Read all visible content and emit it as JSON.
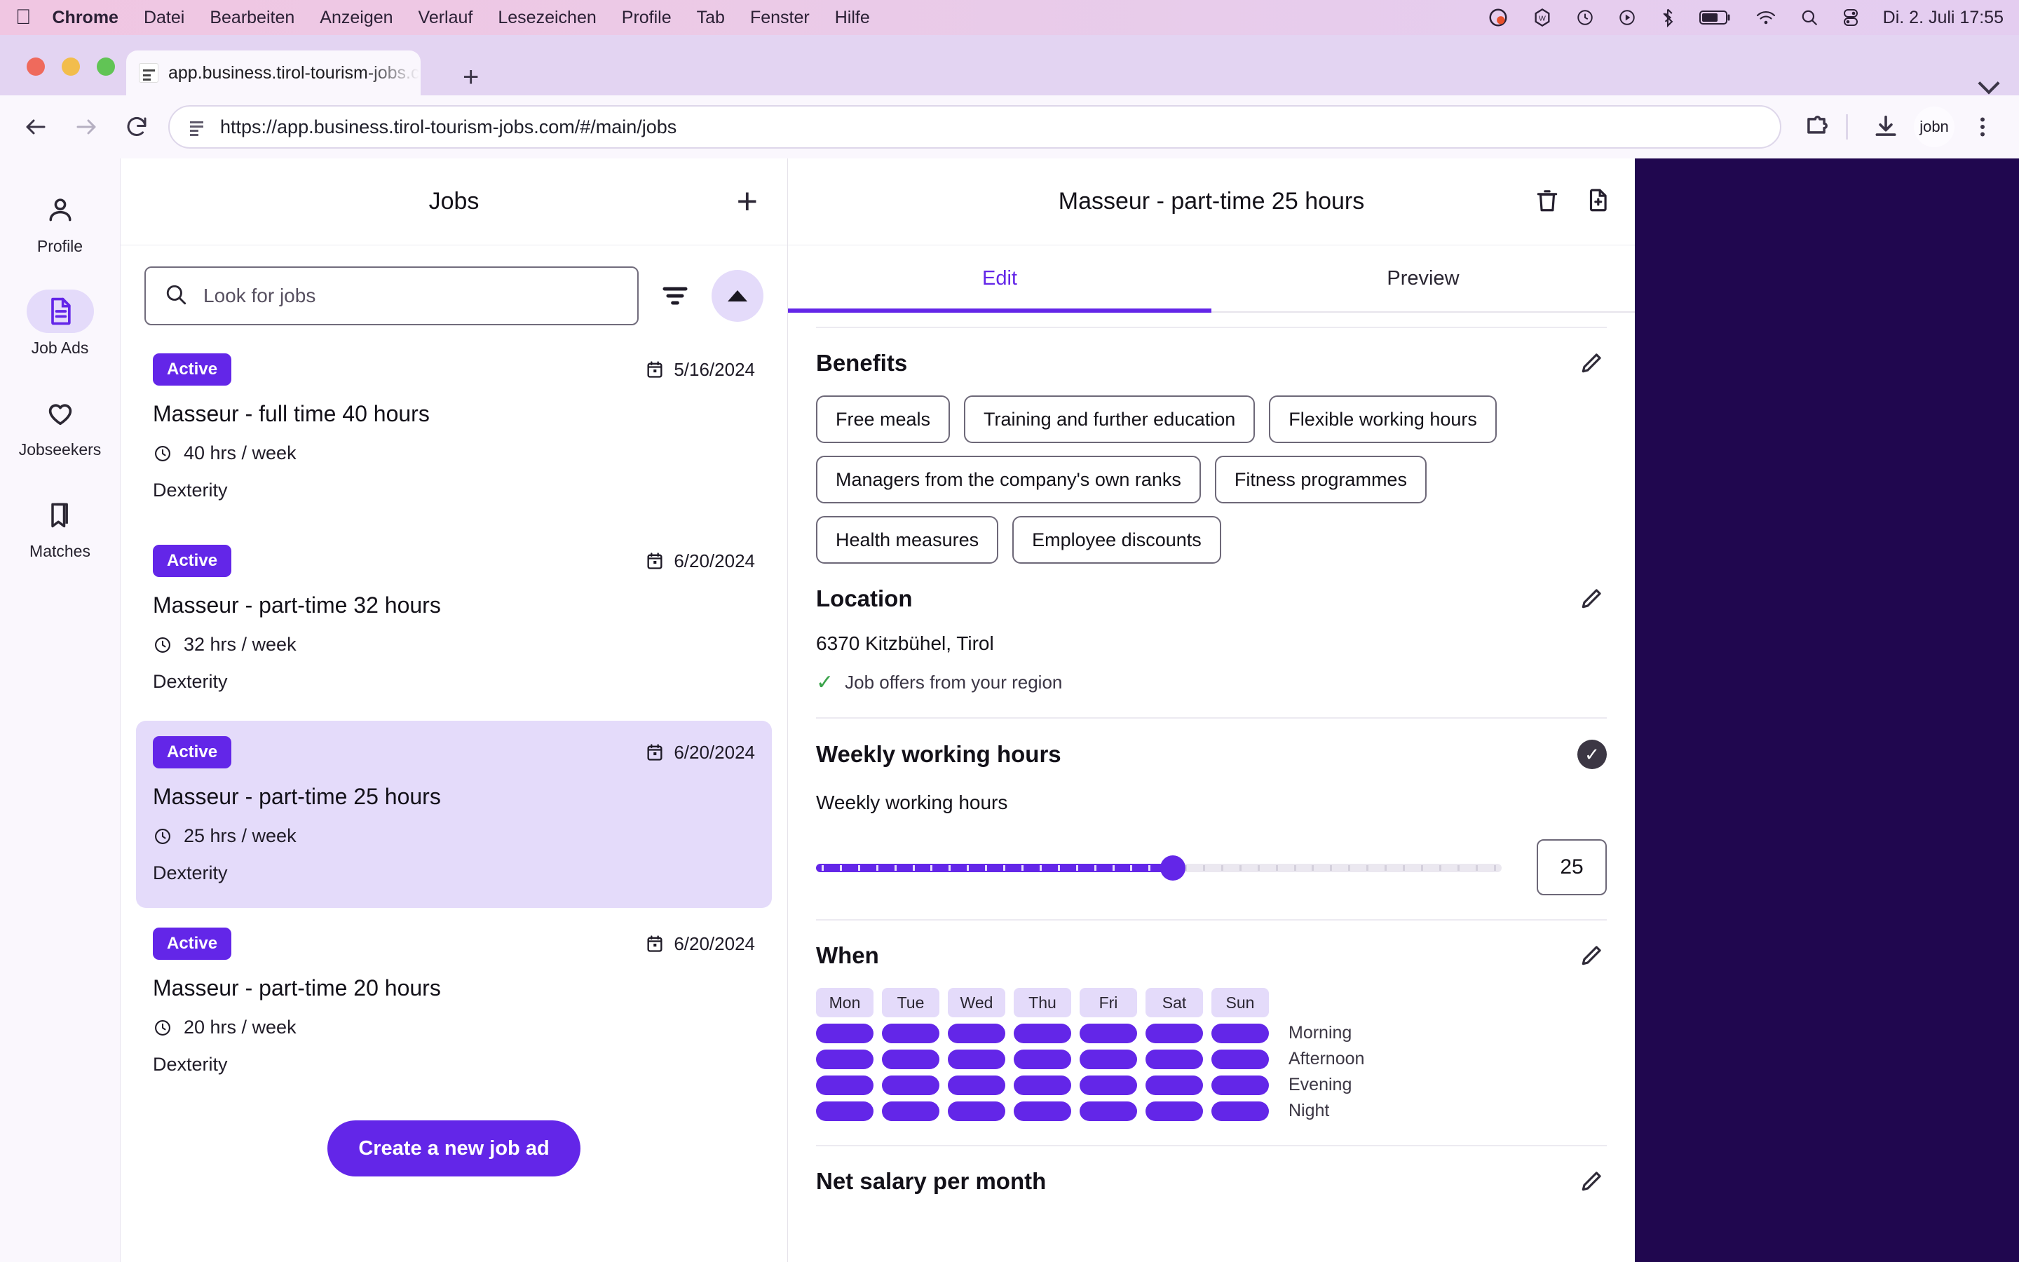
{
  "menubar": {
    "apple": "apple-logo",
    "items": [
      "Chrome",
      "Datei",
      "Bearbeiten",
      "Anzeigen",
      "Verlauf",
      "Lesezeichen",
      "Profile",
      "Tab",
      "Fenster",
      "Hilfe"
    ],
    "status_icons": [
      "grammarly-icon",
      "wordpress-icon",
      "time-machine-icon",
      "screen-record-icon",
      "bluetooth-icon",
      "battery-icon",
      "wifi-icon",
      "spotlight-search-icon",
      "control-center-icon"
    ],
    "clock": "Di. 2. Juli  17:55"
  },
  "browser": {
    "tab_title": "app.business.tirol-tourism-jobs.c",
    "new_tab_label": "+",
    "url": "https://app.business.tirol-tourism-jobs.com/#/main/jobs",
    "avatar_label": "jobn"
  },
  "sidebar": {
    "items": [
      {
        "label": "Profile",
        "icon": "person-icon",
        "active": false
      },
      {
        "label": "Job Ads",
        "icon": "document-icon",
        "active": true
      },
      {
        "label": "Jobseekers",
        "icon": "heart-icon",
        "active": false
      },
      {
        "label": "Matches",
        "icon": "bookmark-icon",
        "active": false
      }
    ]
  },
  "jobs_panel": {
    "title": "Jobs",
    "add_label": "+",
    "search_placeholder": "Look for jobs",
    "search_value": "",
    "filter_icon": "filter-icon",
    "collapse_icon": "chevron-up-icon",
    "create_button": "Create a new job ad",
    "items": [
      {
        "status": "Active",
        "date": "5/16/2024",
        "title": "Masseur - full time 40 hours",
        "hours": "40 hrs / week",
        "skill": "Dexterity",
        "selected": false
      },
      {
        "status": "Active",
        "date": "6/20/2024",
        "title": "Masseur - part-time 32 hours",
        "hours": "32 hrs / week",
        "skill": "Dexterity",
        "selected": false
      },
      {
        "status": "Active",
        "date": "6/20/2024",
        "title": "Masseur - part-time 25 hours",
        "hours": "25 hrs / week",
        "skill": "Dexterity",
        "selected": true
      },
      {
        "status": "Active",
        "date": "6/20/2024",
        "title": "Masseur - part-time 20 hours",
        "hours": "20 hrs / week",
        "skill": "Dexterity",
        "selected": false
      }
    ]
  },
  "detail": {
    "title": "Masseur - part-time 25 hours",
    "delete_icon": "trash-icon",
    "duplicate_icon": "duplicate-document-icon",
    "tabs": [
      {
        "label": "Edit",
        "active": true
      },
      {
        "label": "Preview",
        "active": false
      }
    ],
    "benefits": {
      "heading": "Benefits",
      "edit_icon": "pencil-icon",
      "chips": [
        "Free meals",
        "Training and further education",
        "Flexible working hours",
        "Managers from the company's own ranks",
        "Fitness programmes",
        "Health measures",
        "Employee discounts"
      ]
    },
    "location": {
      "heading": "Location",
      "edit_icon": "pencil-icon",
      "address": "6370 Kitzbühel, Tirol",
      "region_note": "Job offers from your region",
      "region_check_icon": "check-icon"
    },
    "weekly_hours": {
      "heading": "Weekly working hours",
      "confirm_icon": "check-circle-icon",
      "field_label": "Weekly working hours",
      "value": "25",
      "min": 0,
      "max": 50,
      "fill_percent": 52
    },
    "when": {
      "heading": "When",
      "edit_icon": "pencil-icon",
      "days": [
        "Mon",
        "Tue",
        "Wed",
        "Thu",
        "Fri",
        "Sat",
        "Sun"
      ],
      "slots": [
        {
          "label": "Morning",
          "values": [
            true,
            true,
            true,
            true,
            true,
            true,
            true
          ]
        },
        {
          "label": "Afternoon",
          "values": [
            true,
            true,
            true,
            true,
            true,
            true,
            true
          ]
        },
        {
          "label": "Evening",
          "values": [
            true,
            true,
            true,
            true,
            true,
            true,
            true
          ]
        },
        {
          "label": "Night",
          "values": [
            true,
            true,
            true,
            true,
            true,
            true,
            true
          ]
        }
      ]
    },
    "salary": {
      "heading": "Net salary per month",
      "edit_icon": "pencil-icon"
    }
  },
  "colors": {
    "accent": "#6326e8",
    "accent_soft": "#e4dbfa",
    "navy_block": "#20074f",
    "success": "#3aa34a"
  }
}
